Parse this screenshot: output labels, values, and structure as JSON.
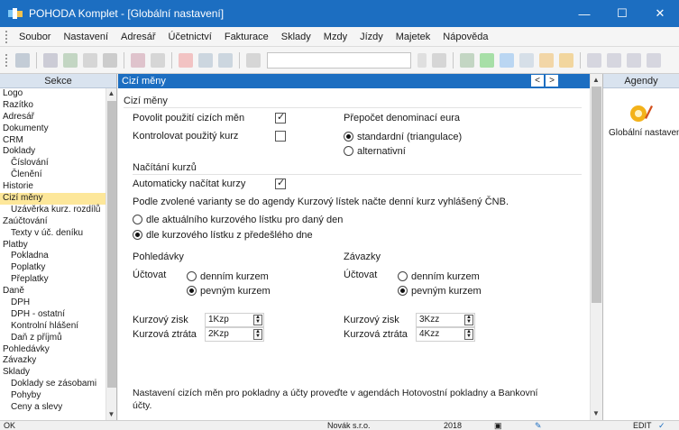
{
  "window": {
    "title": "POHODA Komplet - [Globální nastavení]",
    "buttons": {
      "minimize": "—",
      "maximize": "☐",
      "close": "✕"
    },
    "accent": "#1c6ec1"
  },
  "menu": [
    {
      "label": "Soubor"
    },
    {
      "label": "Nastavení"
    },
    {
      "label": "Adresář"
    },
    {
      "label": "Účetnictví"
    },
    {
      "label": "Fakturace"
    },
    {
      "label": "Sklady"
    },
    {
      "label": "Mzdy"
    },
    {
      "label": "Jízdy"
    },
    {
      "label": "Majetek"
    },
    {
      "label": "Nápověda"
    }
  ],
  "left_panel": {
    "title": "Sekce",
    "items": [
      {
        "label": "Logo",
        "level": 0
      },
      {
        "label": "Razítko",
        "level": 0
      },
      {
        "label": "Adresář",
        "level": 0
      },
      {
        "label": "Dokumenty",
        "level": 0
      },
      {
        "label": "CRM",
        "level": 0
      },
      {
        "label": "Doklady",
        "level": 0
      },
      {
        "label": "Číslování",
        "level": 1
      },
      {
        "label": "Členění",
        "level": 1
      },
      {
        "label": "Historie",
        "level": 0
      },
      {
        "label": "Cizí měny",
        "level": 0,
        "selected": true
      },
      {
        "label": "Uzávěrka kurz. rozdílů",
        "level": 1
      },
      {
        "label": "Zaúčtování",
        "level": 0
      },
      {
        "label": "Texty v úč. deníku",
        "level": 1
      },
      {
        "label": "Platby",
        "level": 0
      },
      {
        "label": "Pokladna",
        "level": 1
      },
      {
        "label": "Poplatky",
        "level": 1
      },
      {
        "label": "Přeplatky",
        "level": 1
      },
      {
        "label": "Daně",
        "level": 0
      },
      {
        "label": "DPH",
        "level": 1
      },
      {
        "label": "DPH - ostatní",
        "level": 1
      },
      {
        "label": "Kontrolní hlášení",
        "level": 1
      },
      {
        "label": "Daň z příjmů",
        "level": 1
      },
      {
        "label": "Pohledávky",
        "level": 0
      },
      {
        "label": "Závazky",
        "level": 0
      },
      {
        "label": "Sklady",
        "level": 0
      },
      {
        "label": "Doklady se zásobami",
        "level": 1
      },
      {
        "label": "Pohyby",
        "level": 1
      },
      {
        "label": "Ceny a slevy",
        "level": 1
      }
    ]
  },
  "center": {
    "header_title": "Cizí měny",
    "nav_prev": "<",
    "nav_next": ">",
    "section_foreign": "Cizí měny",
    "allow_foreign_label": "Povolit použití cizích měn",
    "allow_foreign_checked": true,
    "check_rate_label": "Kontrolovat použitý kurz",
    "check_rate_checked": false,
    "euro_title": "Přepočet denominací eura",
    "euro_opt1": "standardní (triangulace)",
    "euro_opt2": "alternativní",
    "euro_selected": 1,
    "section_rates": "Načítání kurzů",
    "auto_load_label": "Automaticky načítat kurzy",
    "auto_load_checked": true,
    "rates_info": "Podle zvolené varianty se do agendy Kurzový lístek načte denní kurz vyhlášený ČNB.",
    "rates_opt1": "dle aktuálního kurzového lístku pro daný den",
    "rates_opt2": "dle kurzového lístku z předešlého dne",
    "rates_selected": 2,
    "receivables": {
      "title": "Pohledávky",
      "account_label": "Účtovat",
      "opt_daily": "denním kurzem",
      "opt_fixed": "pevným kurzem",
      "selected": 2,
      "gain_label": "Kurzový zisk",
      "gain_value": "1Kzp",
      "loss_label": "Kurzová ztráta",
      "loss_value": "2Kzp"
    },
    "payables": {
      "title": "Závazky",
      "account_label": "Účtovat",
      "opt_daily": "denním kurzem",
      "opt_fixed": "pevným kurzem",
      "selected": 2,
      "gain_label": "Kurzový zisk",
      "gain_value": "3Kzz",
      "loss_label": "Kurzová ztráta",
      "loss_value": "4Kzz"
    },
    "footer_note_line1": "Nastavení cizích měn pro pokladny a účty proveďte v agendách Hotovostní pokladny a Bankovní",
    "footer_note_line2": "účty."
  },
  "right_panel": {
    "title": "Agendy",
    "item_label": "Globální nastavení"
  },
  "status": {
    "left": "OK",
    "company": "Novák s.r.o.",
    "year": "2018",
    "mode": "EDIT"
  }
}
